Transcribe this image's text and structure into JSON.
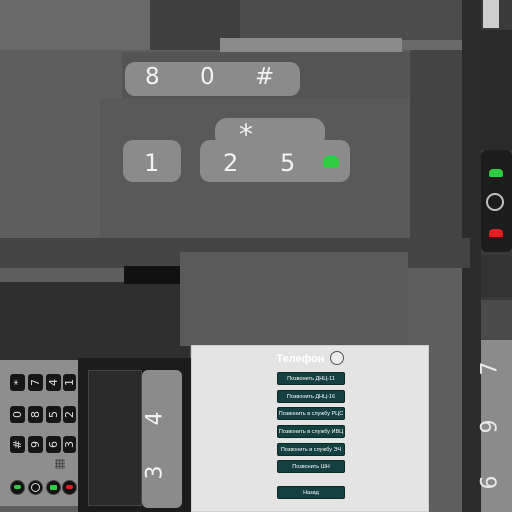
{
  "scene": {
    "keypad_keys": [
      "8",
      "0",
      "#",
      "*",
      "1",
      "2",
      "5"
    ],
    "lower_keys": [
      "4",
      "3"
    ],
    "right_keys": [
      "7",
      "9",
      "6"
    ],
    "mini_keypad": [
      "*",
      "7",
      "4",
      "1",
      "0",
      "8",
      "5",
      "2",
      "#",
      "9",
      "6",
      "3"
    ],
    "colors": {
      "handset_green": "#2ecc40",
      "handset_red": "#e02020",
      "dialog_button": "#14403f"
    }
  },
  "dialog": {
    "title": "Телефон",
    "buttons": [
      "Позвонить ДНЦ-11",
      "Позвонить ДНЦ-16",
      "Позвонить в службу РЦС",
      "Позвонить в службу ИВЦ",
      "Позвонить в службу ЭЧ",
      "Позвонить ШН"
    ],
    "back_label": "Назад"
  },
  "icons": {
    "dialog_phone": "phone-icon",
    "call_accept": "green-handset-icon",
    "call_end": "red-handset-icon",
    "refresh": "refresh-icon"
  }
}
